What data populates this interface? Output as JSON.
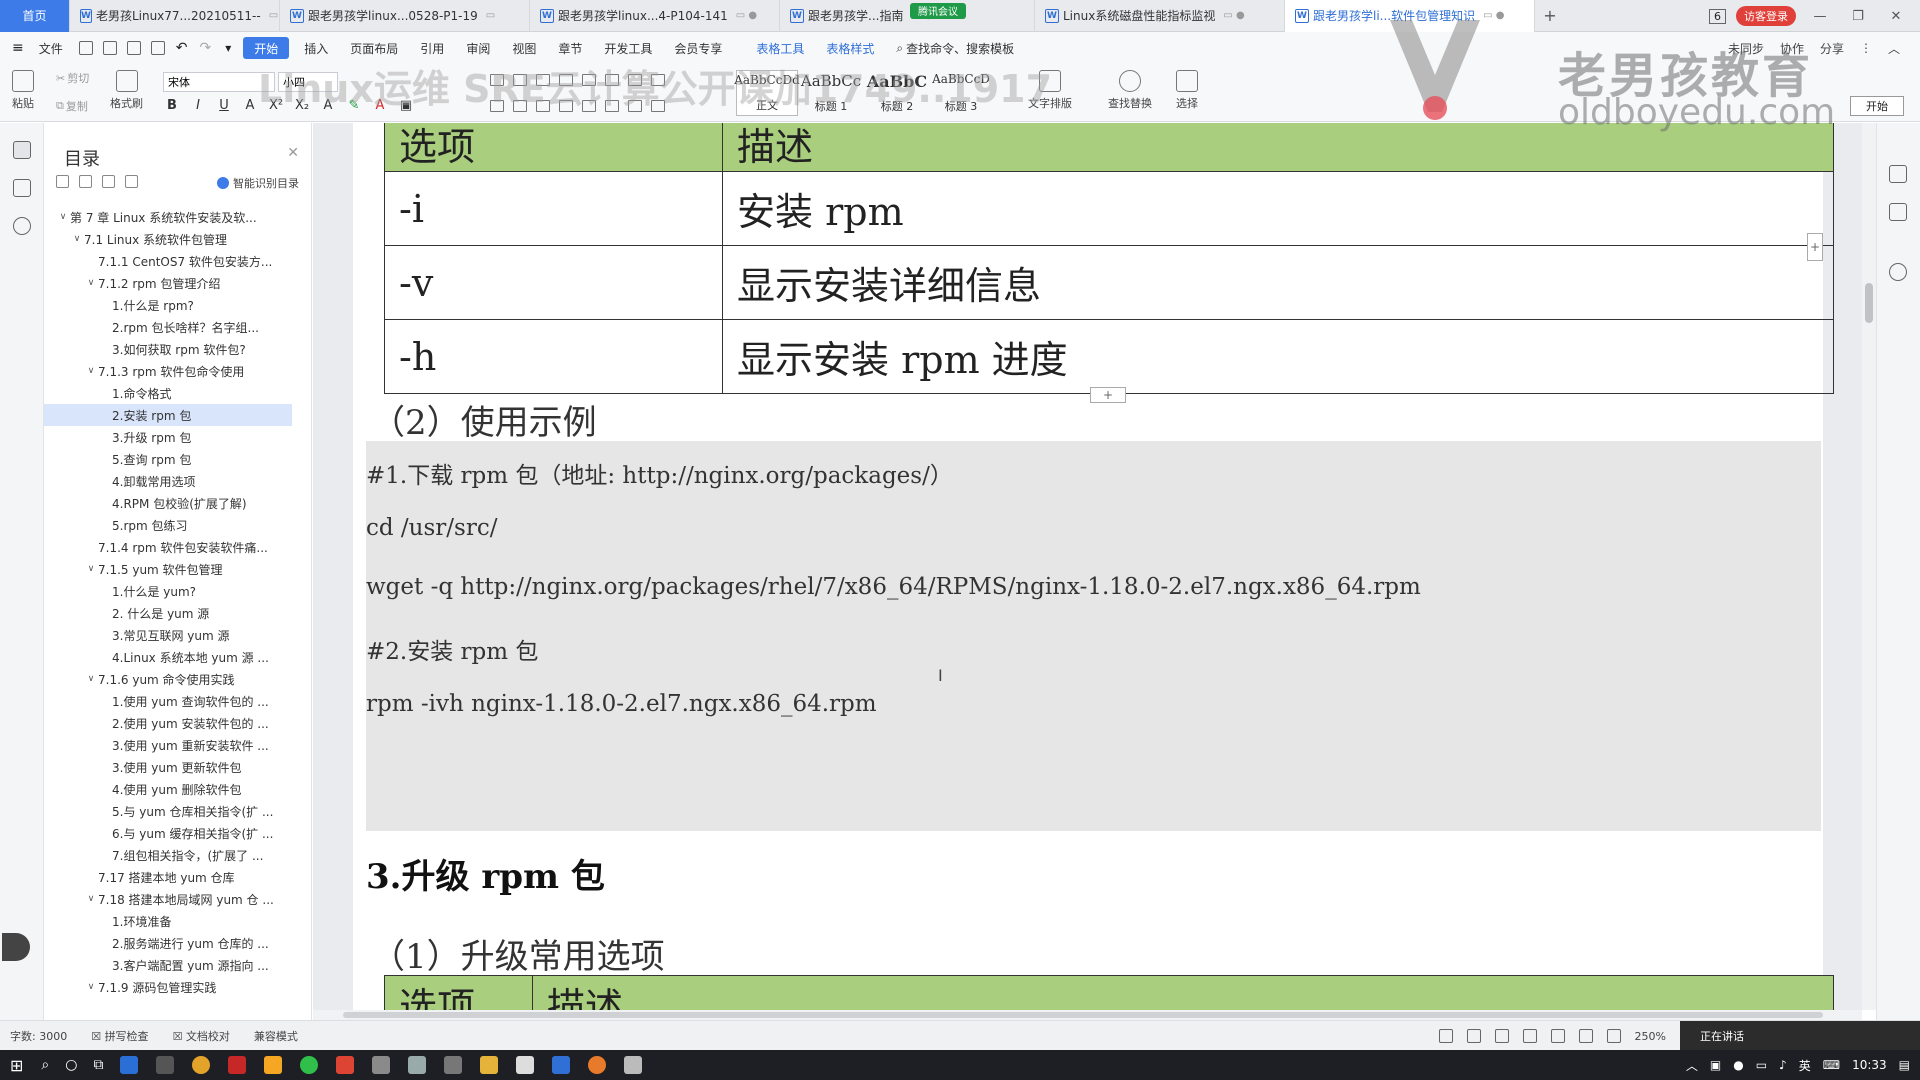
{
  "tabs": [
    {
      "label": "首页",
      "type": "home"
    },
    {
      "label": "老男孩Linux77...20210511--",
      "type": "doc"
    },
    {
      "label": "跟老男孩学linux...0528-P1-19",
      "type": "doc"
    },
    {
      "label": "跟老男孩学linux...4-P104-141",
      "type": "doc"
    },
    {
      "label": "跟老男孩学...指南",
      "type": "doc"
    },
    {
      "label": "Linux系统磁盘性能指标监视",
      "type": "doc"
    },
    {
      "label": "跟老男孩学li...软件包管理知识",
      "type": "doc",
      "active": true
    }
  ],
  "tab_add": "+",
  "tab_count": "6",
  "visitor_login": "访客登录",
  "meeting_label": "腾讯会议",
  "menu": {
    "file": "文件",
    "items": [
      "开始",
      "插入",
      "页面布局",
      "引用",
      "审阅",
      "视图",
      "章节",
      "开发工具",
      "会员专享"
    ],
    "table_tools": "表格工具",
    "table_style": "表格样式",
    "search": "查找命令、搜索模板",
    "right": [
      "未同步",
      "协作",
      "分享"
    ]
  },
  "toolbar": {
    "paste": "粘贴",
    "cut": "剪切",
    "copy": "复制",
    "format_painter": "格式刷",
    "font_name": "宋体",
    "font_size": "小四",
    "styles": [
      {
        "preview": "AaBbCcDd",
        "label": "正文"
      },
      {
        "preview": "AaBbCc",
        "label": "标题 1"
      },
      {
        "preview": "AaBbC",
        "label": "标题 2"
      },
      {
        "preview": "AaBbCcD",
        "label": "标题 3"
      }
    ],
    "text_layout": "文字排版",
    "find_replace": "查找替换",
    "select": "选择",
    "start_button": "开始"
  },
  "watermark": {
    "cn": "老男孩教育",
    "en": "oldboyedu.com",
    "overlay": "Linux运维 SRE云计算公开课加1749..1917"
  },
  "toc": {
    "title": "目录",
    "smart": "智能识别目录",
    "items": [
      {
        "label": "第 7 章   Linux 系统软件安装及软...",
        "level": 0,
        "arrow": "down"
      },
      {
        "label": "7.1 Linux 系统软件包管理",
        "level": 1,
        "arrow": "down"
      },
      {
        "label": "7.1.1 CentOS7 软件包安装方...",
        "level": 2,
        "arrow": ""
      },
      {
        "label": "7.1.2 rpm 包管理介绍",
        "level": 2,
        "arrow": "down"
      },
      {
        "label": "1.什么是 rpm?",
        "level": 3,
        "arrow": ""
      },
      {
        "label": "2.rpm 包长啥样？名字组...",
        "level": 3,
        "arrow": ""
      },
      {
        "label": "3.如何获取 rpm 软件包?",
        "level": 3,
        "arrow": ""
      },
      {
        "label": "7.1.3 rpm 软件包命令使用",
        "level": 2,
        "arrow": "down"
      },
      {
        "label": "1.命令格式",
        "level": 3,
        "arrow": ""
      },
      {
        "label": "2.安装 rpm 包",
        "level": 3,
        "arrow": "",
        "selected": true
      },
      {
        "label": "3.升级 rpm 包",
        "level": 3,
        "arrow": ""
      },
      {
        "label": "5.查询 rpm 包",
        "level": 3,
        "arrow": ""
      },
      {
        "label": "4.卸载常用选项",
        "level": 3,
        "arrow": ""
      },
      {
        "label": "4.RPM 包校验(扩展了解)",
        "level": 3,
        "arrow": ""
      },
      {
        "label": "5.rpm 包练习",
        "level": 3,
        "arrow": ""
      },
      {
        "label": "7.1.4 rpm 软件包安装软件痛...",
        "level": 2,
        "arrow": ""
      },
      {
        "label": "7.1.5    yum 软件包管理",
        "level": 2,
        "arrow": "down"
      },
      {
        "label": "1.什么是 yum?",
        "level": 3,
        "arrow": ""
      },
      {
        "label": "2. 什么是 yum 源",
        "level": 3,
        "arrow": ""
      },
      {
        "label": "3.常见互联网 yum 源",
        "level": 3,
        "arrow": ""
      },
      {
        "label": "4.Linux 系统本地 yum 源 ...",
        "level": 3,
        "arrow": ""
      },
      {
        "label": "7.1.6 yum 命令使用实践",
        "level": 2,
        "arrow": "down"
      },
      {
        "label": "1.使用 yum 查询软件包的 ...",
        "level": 3,
        "arrow": ""
      },
      {
        "label": "2.使用 yum 安装软件包的 ...",
        "level": 3,
        "arrow": ""
      },
      {
        "label": "3.使用 yum 重新安装软件 ...",
        "level": 3,
        "arrow": ""
      },
      {
        "label": "3.使用 yum 更新软件包",
        "level": 3,
        "arrow": ""
      },
      {
        "label": "4.使用 yum 删除软件包",
        "level": 3,
        "arrow": ""
      },
      {
        "label": "5.与 yum 仓库相关指令(扩 ...",
        "level": 3,
        "arrow": ""
      },
      {
        "label": "6.与 yum 缓存相关指令(扩 ...",
        "level": 3,
        "arrow": ""
      },
      {
        "label": "7.组包相关指令，(扩展了 ...",
        "level": 3,
        "arrow": ""
      },
      {
        "label": "7.17  搭建本地 yum 仓库",
        "level": 2,
        "arrow": ""
      },
      {
        "label": "7.18 搭建本地局域网 yum 仓 ...",
        "level": 2,
        "arrow": "down"
      },
      {
        "label": "1.环境准备",
        "level": 3,
        "arrow": ""
      },
      {
        "label": "2.服务端进行 yum 仓库的 ...",
        "level": 3,
        "arrow": ""
      },
      {
        "label": "3.客户端配置 yum 源指向 ...",
        "level": 3,
        "arrow": ""
      },
      {
        "label": "7.1.9  源码包管理实践",
        "level": 2,
        "arrow": "down"
      }
    ]
  },
  "document": {
    "table1": {
      "header": [
        "选项",
        "描述"
      ],
      "rows": [
        [
          "-i",
          "安装 rpm"
        ],
        [
          "-v",
          "显示安装详细信息"
        ],
        [
          "-h",
          "显示安装 rpm 进度"
        ]
      ]
    },
    "example_heading": "（2）使用示例",
    "code_lines": [
      "#1.下载 rpm 包（地址: http://nginx.org/packages/）",
      "cd /usr/src/",
      "wget -q http://nginx.org/packages/rhel/7/x86_64/RPMS/nginx-1.18.0-2.el7.ngx.x86_64.rpm",
      "#2.安装 rpm 包",
      "rpm -ivh nginx-1.18.0-2.el7.ngx.x86_64.rpm"
    ],
    "section3": "3.升级 rpm 包",
    "upgrade_heading": "（1）升级常用选项",
    "table2_header": [
      "选项",
      "描述"
    ]
  },
  "status": {
    "word_count": "字数: 3000",
    "spell_check": "拼写检查",
    "doc_check": "文档校对",
    "compat_mode": "兼容模式",
    "zoom": "250%",
    "presenting": "正在讲话"
  },
  "taskbar": {
    "ime": "英",
    "time": "10:33"
  },
  "colors": {
    "accent": "#3d7be8",
    "table_header": "#a9cf7e",
    "code_bg": "#e6e6e6",
    "selected_toc": "#d9e5fb"
  }
}
